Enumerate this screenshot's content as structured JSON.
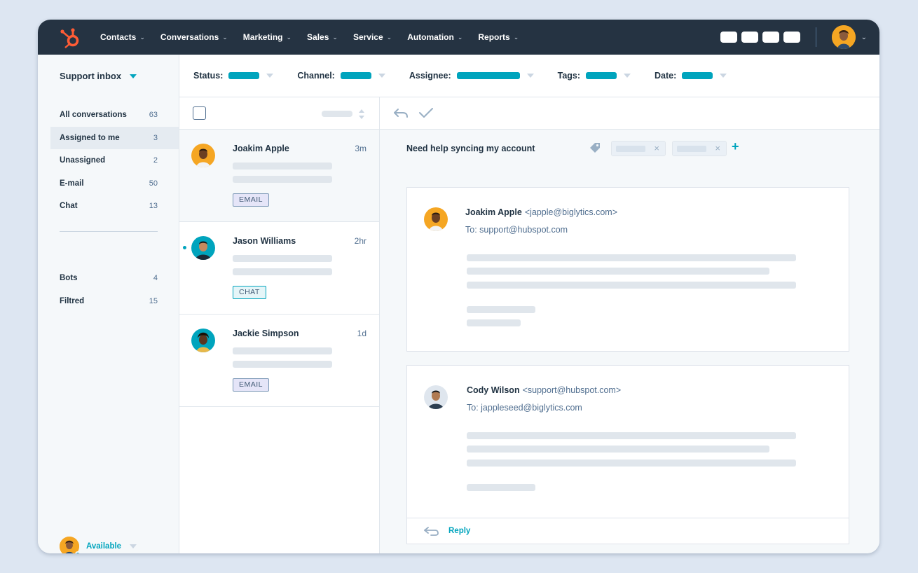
{
  "topnav": {
    "items": [
      {
        "label": "Contacts"
      },
      {
        "label": "Conversations"
      },
      {
        "label": "Marketing"
      },
      {
        "label": "Sales"
      },
      {
        "label": "Service"
      },
      {
        "label": "Automation"
      },
      {
        "label": "Reports"
      }
    ],
    "caret": "⌄"
  },
  "sidebar": {
    "title": "Support inbox",
    "items": [
      {
        "label": "All conversations",
        "count": "63"
      },
      {
        "label": "Assigned to me",
        "count": "3"
      },
      {
        "label": "Unassigned",
        "count": "2"
      },
      {
        "label": "E-mail",
        "count": "50"
      },
      {
        "label": "Chat",
        "count": "13"
      }
    ],
    "items2": [
      {
        "label": "Bots",
        "count": "4"
      },
      {
        "label": "Filtred",
        "count": "15"
      }
    ],
    "status": "Available"
  },
  "filters": {
    "status": "Status:",
    "channel": "Channel:",
    "assignee": "Assignee:",
    "tags": "Tags:",
    "date": "Date:"
  },
  "conversations": [
    {
      "name": "Joakim Apple",
      "time": "3m",
      "tag": "EMAIL"
    },
    {
      "name": "Jason Williams",
      "time": "2hr",
      "tag": "CHAT"
    },
    {
      "name": "Jackie Simpson",
      "time": "1d",
      "tag": "EMAIL"
    }
  ],
  "detail": {
    "subject": "Need help syncing my account",
    "chip_close": "×",
    "add": "+",
    "messages": [
      {
        "from": "Joakim Apple",
        "addr": "<japple@biglytics.com>",
        "to": "To: support@hubspot.com"
      },
      {
        "from": "Cody Wilson",
        "addr": "<support@hubspot.com>",
        "to": "To: jappleseed@biglytics.com"
      }
    ],
    "reply": "Reply"
  },
  "colors": {
    "accent": "#00a4bd",
    "nav": "#253342",
    "brand": "#ff5c35"
  }
}
